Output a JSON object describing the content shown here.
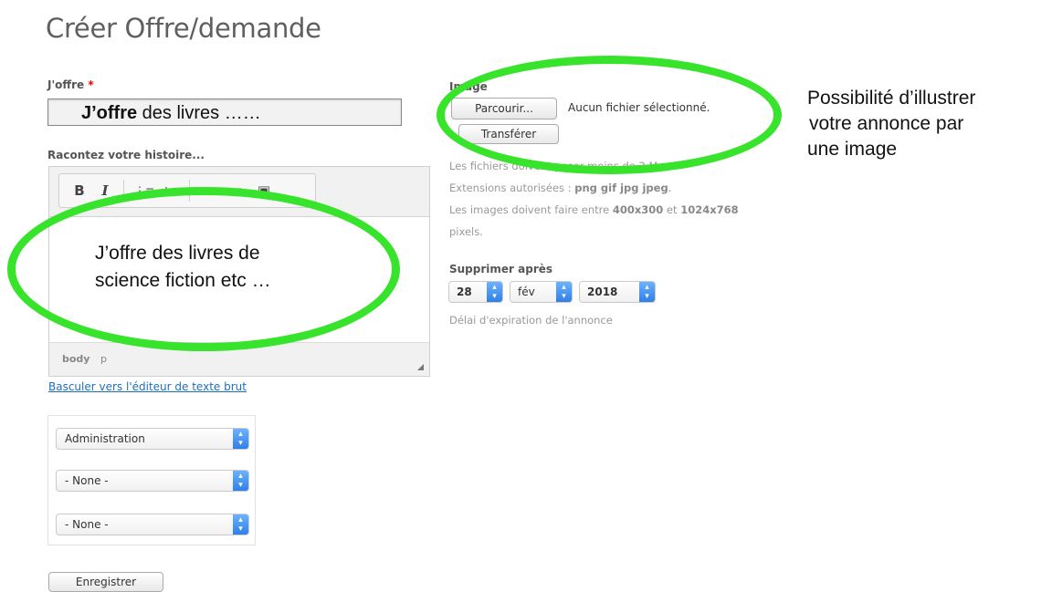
{
  "page": {
    "title": "Créer Offre/demande"
  },
  "offer": {
    "label": "J'offre",
    "required_mark": "*",
    "value_bold": "J’offre",
    "value_rest": " des livres ……"
  },
  "story": {
    "label": "Racontez votre histoire...",
    "toolbar": {
      "bold": "B",
      "italic": "I",
      "numbered_list": "⋮≡",
      "bullet_list": "⁝≡",
      "link": "⚭",
      "unlink": "⚮",
      "image": "▣"
    },
    "body_line1": "J’offre des livres de",
    "body_line2": "science fiction etc …",
    "status_path": "body",
    "status_path2": "p",
    "switch_link": "Basculer vers l'éditeur de texte brut"
  },
  "taxonomy": {
    "selects": [
      {
        "value": "Administration"
      },
      {
        "value": "- None -"
      },
      {
        "value": "- None -"
      }
    ]
  },
  "save_button": "Enregistrer",
  "image": {
    "label": "Image",
    "browse_button": "Parcourir...",
    "no_file_text": "Aucun fichier sélectionné.",
    "upload_button": "Transférer",
    "help_line1": "Les fichiers doivent peser moins de 2 Mo.",
    "help_line2_prefix": "Extensions autorisées : ",
    "help_line2_exts": "png gif jpg jpeg",
    "help_line2_suffix": ".",
    "help_line3_prefix": "Les images doivent faire entre ",
    "help_line3_bold": "400x300",
    "help_line3_mid": " et ",
    "help_line3_bold2": "1024x768",
    "help_line4": "pixels."
  },
  "expiry": {
    "label": "Supprimer après",
    "day": "28",
    "month": "fév",
    "year": "2018",
    "help": "Délai d'expiration de l'annonce"
  },
  "annotation": {
    "line1": "Possibilité d’illustrer",
    "line2": "votre annonce par",
    "line3": "une image"
  },
  "colors": {
    "highlight": "#37e32b",
    "link": "#1d6fb8",
    "select_arrow": "#2f7fe6"
  },
  "icons": {
    "select_arrows": "chevron-up-down-icon",
    "resize_grip": "resize-grip-icon"
  }
}
